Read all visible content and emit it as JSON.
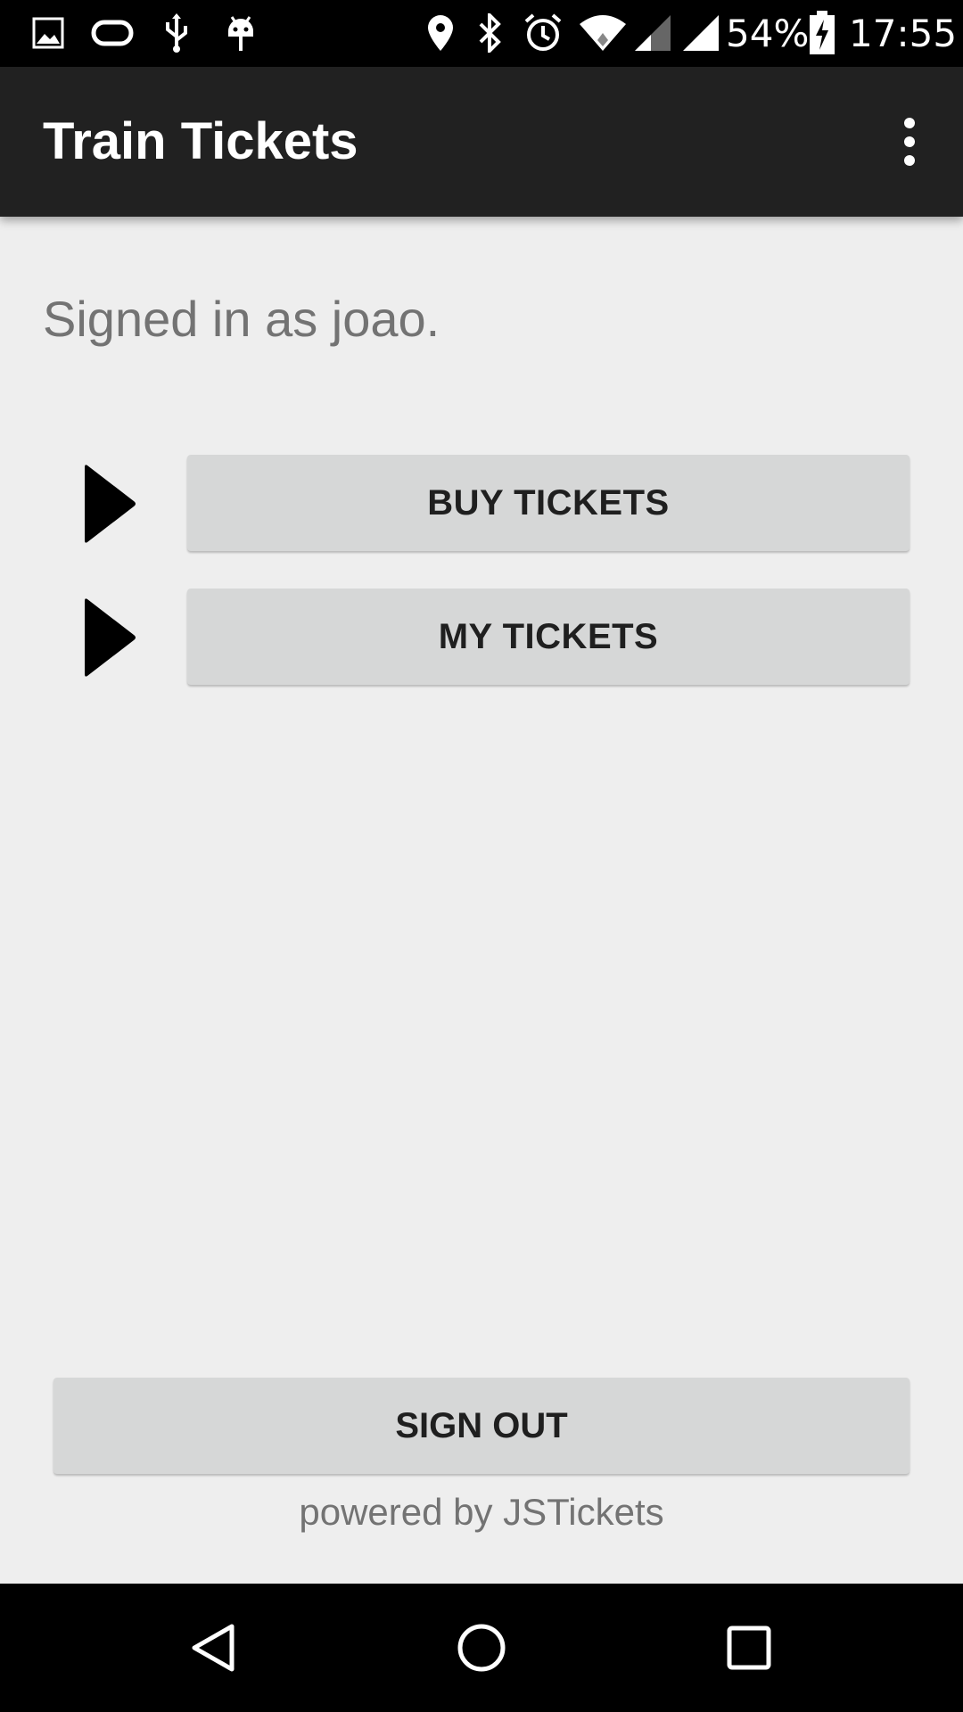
{
  "status_bar": {
    "battery_percent": "54%",
    "time": "17:55",
    "left_icons": [
      "image-icon",
      "sync-icon",
      "usb-icon",
      "android-debug-icon"
    ],
    "right_icons": [
      "location-icon",
      "bluetooth-icon",
      "alarm-icon",
      "wifi-icon",
      "signal-icon",
      "signal-icon",
      "battery-charging-icon"
    ]
  },
  "app_bar": {
    "title": "Train Tickets",
    "menu_icon": "overflow-menu-icon"
  },
  "main": {
    "signed_in_text": "Signed in as joao.",
    "actions": [
      {
        "label": "BUY TICKETS",
        "icon": "play-arrow-icon"
      },
      {
        "label": "MY TICKETS",
        "icon": "play-arrow-icon"
      }
    ],
    "sign_out_label": "SIGN OUT",
    "powered_by": "powered by JSTickets"
  },
  "nav_bar": {
    "buttons": [
      "back-icon",
      "home-icon",
      "recents-icon"
    ]
  },
  "colors": {
    "app_bar": "#212121",
    "background": "#eeeeee",
    "button": "#d6d7d7",
    "secondary_text": "#737373"
  }
}
